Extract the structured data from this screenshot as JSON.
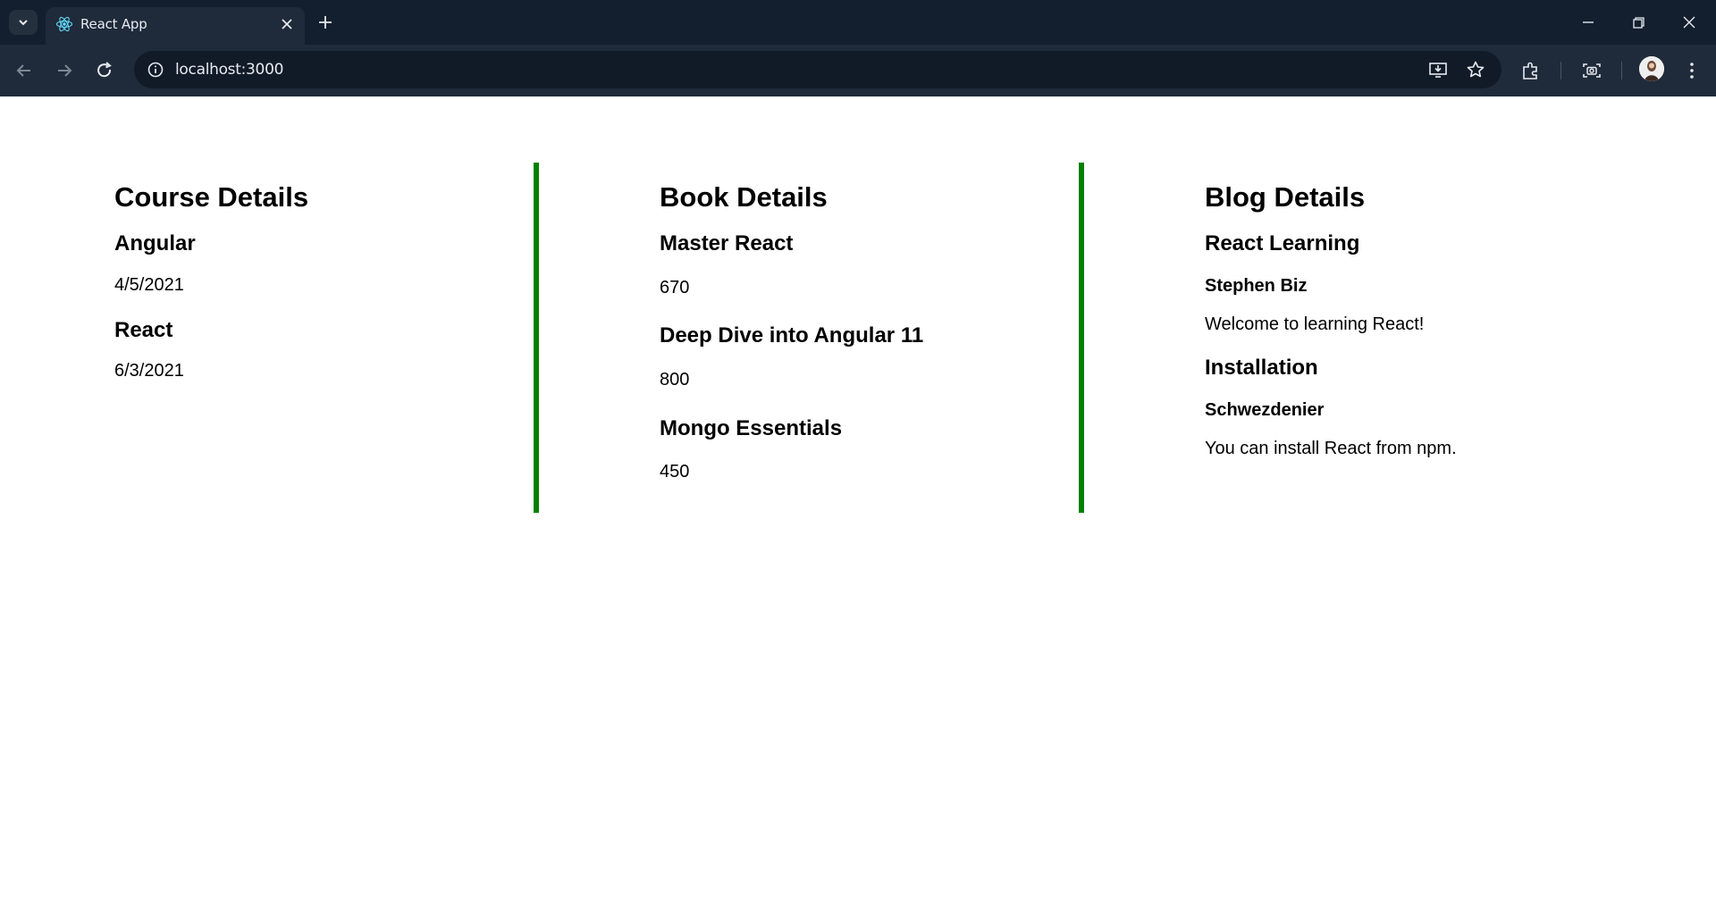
{
  "browser": {
    "tab_title": "React App",
    "url": "localhost:3000",
    "icons": {
      "tab_search": "chevron-down-icon",
      "favicon": "react-icon",
      "tab_close": "close-icon",
      "new_tab": "plus-icon",
      "minimize": "minimize-icon",
      "restore": "restore-icon",
      "close_window": "close-icon",
      "back": "arrow-left-icon",
      "forward": "arrow-right-icon",
      "reload": "reload-icon",
      "site_info": "info-icon",
      "install": "install-app-icon",
      "bookmark": "star-icon",
      "extensions": "puzzle-icon",
      "screenshot": "camera-icon",
      "profile": "avatar",
      "menu": "kebab-menu-icon"
    }
  },
  "course": {
    "title": "Course Details",
    "items": [
      {
        "name": "Angular",
        "date": "4/5/2021"
      },
      {
        "name": "React",
        "date": "6/3/2021"
      }
    ]
  },
  "book": {
    "title": "Book Details",
    "items": [
      {
        "name": "Master React",
        "price": "670"
      },
      {
        "name": "Deep Dive into Angular 11",
        "price": "800"
      },
      {
        "name": "Mongo Essentials",
        "price": "450"
      }
    ]
  },
  "blog": {
    "title": "Blog Details",
    "items": [
      {
        "title": "React Learning",
        "author": "Stephen Biz",
        "content": "Welcome to learning React!"
      },
      {
        "title": "Installation",
        "author": "Schwezdenier",
        "content": "You can install React from npm."
      }
    ]
  },
  "colors": {
    "divider": "#008000",
    "tabbar_bg": "#131f2e",
    "toolbar_bg": "#1f2b3a"
  }
}
